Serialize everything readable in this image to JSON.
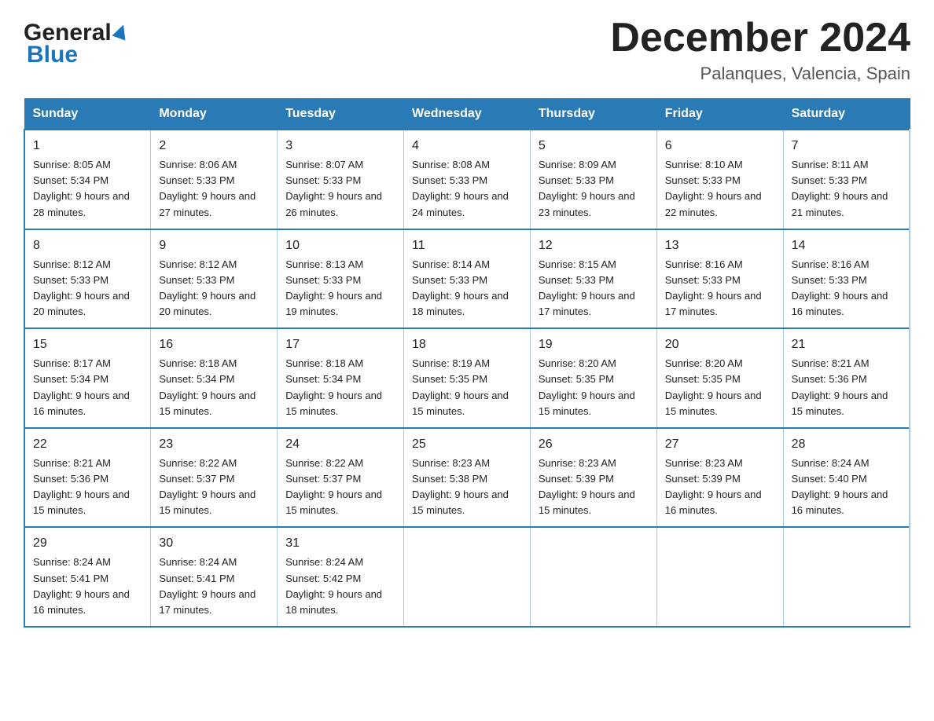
{
  "header": {
    "logo_general": "General",
    "logo_blue": "Blue",
    "month_title": "December 2024",
    "location": "Palanques, Valencia, Spain"
  },
  "weekdays": [
    "Sunday",
    "Monday",
    "Tuesday",
    "Wednesday",
    "Thursday",
    "Friday",
    "Saturday"
  ],
  "weeks": [
    [
      {
        "day": "1",
        "sunrise": "8:05 AM",
        "sunset": "5:34 PM",
        "daylight": "9 hours and 28 minutes."
      },
      {
        "day": "2",
        "sunrise": "8:06 AM",
        "sunset": "5:33 PM",
        "daylight": "9 hours and 27 minutes."
      },
      {
        "day": "3",
        "sunrise": "8:07 AM",
        "sunset": "5:33 PM",
        "daylight": "9 hours and 26 minutes."
      },
      {
        "day": "4",
        "sunrise": "8:08 AM",
        "sunset": "5:33 PM",
        "daylight": "9 hours and 24 minutes."
      },
      {
        "day": "5",
        "sunrise": "8:09 AM",
        "sunset": "5:33 PM",
        "daylight": "9 hours and 23 minutes."
      },
      {
        "day": "6",
        "sunrise": "8:10 AM",
        "sunset": "5:33 PM",
        "daylight": "9 hours and 22 minutes."
      },
      {
        "day": "7",
        "sunrise": "8:11 AM",
        "sunset": "5:33 PM",
        "daylight": "9 hours and 21 minutes."
      }
    ],
    [
      {
        "day": "8",
        "sunrise": "8:12 AM",
        "sunset": "5:33 PM",
        "daylight": "9 hours and 20 minutes."
      },
      {
        "day": "9",
        "sunrise": "8:12 AM",
        "sunset": "5:33 PM",
        "daylight": "9 hours and 20 minutes."
      },
      {
        "day": "10",
        "sunrise": "8:13 AM",
        "sunset": "5:33 PM",
        "daylight": "9 hours and 19 minutes."
      },
      {
        "day": "11",
        "sunrise": "8:14 AM",
        "sunset": "5:33 PM",
        "daylight": "9 hours and 18 minutes."
      },
      {
        "day": "12",
        "sunrise": "8:15 AM",
        "sunset": "5:33 PM",
        "daylight": "9 hours and 17 minutes."
      },
      {
        "day": "13",
        "sunrise": "8:16 AM",
        "sunset": "5:33 PM",
        "daylight": "9 hours and 17 minutes."
      },
      {
        "day": "14",
        "sunrise": "8:16 AM",
        "sunset": "5:33 PM",
        "daylight": "9 hours and 16 minutes."
      }
    ],
    [
      {
        "day": "15",
        "sunrise": "8:17 AM",
        "sunset": "5:34 PM",
        "daylight": "9 hours and 16 minutes."
      },
      {
        "day": "16",
        "sunrise": "8:18 AM",
        "sunset": "5:34 PM",
        "daylight": "9 hours and 15 minutes."
      },
      {
        "day": "17",
        "sunrise": "8:18 AM",
        "sunset": "5:34 PM",
        "daylight": "9 hours and 15 minutes."
      },
      {
        "day": "18",
        "sunrise": "8:19 AM",
        "sunset": "5:35 PM",
        "daylight": "9 hours and 15 minutes."
      },
      {
        "day": "19",
        "sunrise": "8:20 AM",
        "sunset": "5:35 PM",
        "daylight": "9 hours and 15 minutes."
      },
      {
        "day": "20",
        "sunrise": "8:20 AM",
        "sunset": "5:35 PM",
        "daylight": "9 hours and 15 minutes."
      },
      {
        "day": "21",
        "sunrise": "8:21 AM",
        "sunset": "5:36 PM",
        "daylight": "9 hours and 15 minutes."
      }
    ],
    [
      {
        "day": "22",
        "sunrise": "8:21 AM",
        "sunset": "5:36 PM",
        "daylight": "9 hours and 15 minutes."
      },
      {
        "day": "23",
        "sunrise": "8:22 AM",
        "sunset": "5:37 PM",
        "daylight": "9 hours and 15 minutes."
      },
      {
        "day": "24",
        "sunrise": "8:22 AM",
        "sunset": "5:37 PM",
        "daylight": "9 hours and 15 minutes."
      },
      {
        "day": "25",
        "sunrise": "8:23 AM",
        "sunset": "5:38 PM",
        "daylight": "9 hours and 15 minutes."
      },
      {
        "day": "26",
        "sunrise": "8:23 AM",
        "sunset": "5:39 PM",
        "daylight": "9 hours and 15 minutes."
      },
      {
        "day": "27",
        "sunrise": "8:23 AM",
        "sunset": "5:39 PM",
        "daylight": "9 hours and 16 minutes."
      },
      {
        "day": "28",
        "sunrise": "8:24 AM",
        "sunset": "5:40 PM",
        "daylight": "9 hours and 16 minutes."
      }
    ],
    [
      {
        "day": "29",
        "sunrise": "8:24 AM",
        "sunset": "5:41 PM",
        "daylight": "9 hours and 16 minutes."
      },
      {
        "day": "30",
        "sunrise": "8:24 AM",
        "sunset": "5:41 PM",
        "daylight": "9 hours and 17 minutes."
      },
      {
        "day": "31",
        "sunrise": "8:24 AM",
        "sunset": "5:42 PM",
        "daylight": "9 hours and 18 minutes."
      },
      null,
      null,
      null,
      null
    ]
  ]
}
